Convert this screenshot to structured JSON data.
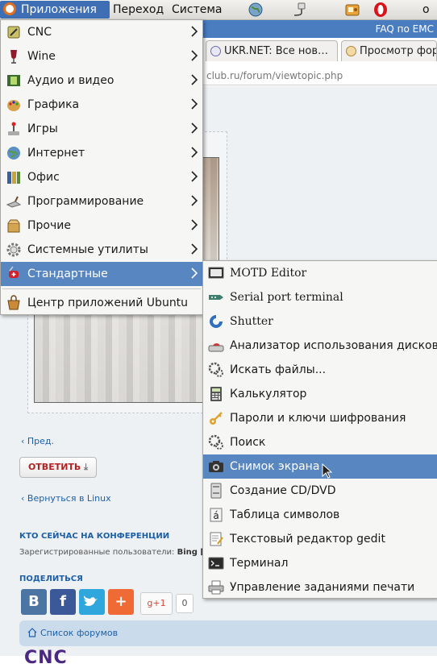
{
  "panel": {
    "apps_label": "Приложения",
    "go_label": "Переход",
    "system_label": "Система",
    "faq_text": "FAQ по ЕМС"
  },
  "browser": {
    "tab1_title": "UKR.NET: Все нов…",
    "tab2_title": "Просмотр фор",
    "url_text": "club.ru/forum/viewtopic.php"
  },
  "page": {
    "prev_link": "Пред.",
    "reply_label": "ОТВЕТИТЬ",
    "back_link": "Вернуться в Linux",
    "online_heading": "КТО СЕЙЧАС НА КОНФЕРЕНЦИИ",
    "online_text": "Зарегистрированные пользователи:",
    "online_user": "Bing [B",
    "share_heading": "ПОДЕЛИТЬСЯ",
    "share_vk": "B",
    "share_fb": "f",
    "share_plus": "+",
    "gplus_label": "+1",
    "share_count": "0",
    "forum_list_link": "Список форумов",
    "logo_text": "CNC"
  },
  "apps_menu": {
    "items": [
      {
        "label": "CNC",
        "icon": "cnc-icon"
      },
      {
        "label": "Wine",
        "icon": "wine-icon"
      },
      {
        "label": "Аудио и видео",
        "icon": "film-icon"
      },
      {
        "label": "Графика",
        "icon": "palette-icon"
      },
      {
        "label": "Игры",
        "icon": "joystick-icon"
      },
      {
        "label": "Интернет",
        "icon": "globe-icon"
      },
      {
        "label": "Офис",
        "icon": "binders-icon"
      },
      {
        "label": "Программирование",
        "icon": "trowel-icon"
      },
      {
        "label": "Прочие",
        "icon": "box-icon"
      },
      {
        "label": "Системные утилиты",
        "icon": "gear-icon"
      },
      {
        "label": "Стандартные",
        "icon": "swiss-knife-icon"
      }
    ],
    "software_center": "Центр приложений Ubuntu"
  },
  "accessories_menu": {
    "items": [
      {
        "label": "MOTD Editor",
        "icon": "monitor-icon"
      },
      {
        "label": "Serial port terminal",
        "icon": "serial-plug-icon"
      },
      {
        "label": "Shutter",
        "icon": "shutter-icon"
      },
      {
        "label": "Анализатор использования дисков",
        "icon": "disk-usage-icon"
      },
      {
        "label": "Искать файлы...",
        "icon": "search-gears-icon"
      },
      {
        "label": "Калькулятор",
        "icon": "calculator-icon"
      },
      {
        "label": "Пароли и ключи шифрования",
        "icon": "keys-icon"
      },
      {
        "label": "Поиск",
        "icon": "search-gears-icon"
      },
      {
        "label": "Снимок экрана",
        "icon": "camera-icon"
      },
      {
        "label": "Создание CD/DVD",
        "icon": "cd-burner-icon"
      },
      {
        "label": "Таблица символов",
        "icon": "charmap-icon"
      },
      {
        "label": "Текстовый редактор gedit",
        "icon": "text-editor-icon"
      },
      {
        "label": "Терминал",
        "icon": "terminal-icon"
      },
      {
        "label": "Управление заданиями печати",
        "icon": "printer-icon"
      }
    ],
    "highlighted_index": 8
  },
  "colors": {
    "menu_highlight": "#5786c1",
    "panel_active": "#3e6eb4",
    "faq_bar": "#4a7dc0"
  }
}
